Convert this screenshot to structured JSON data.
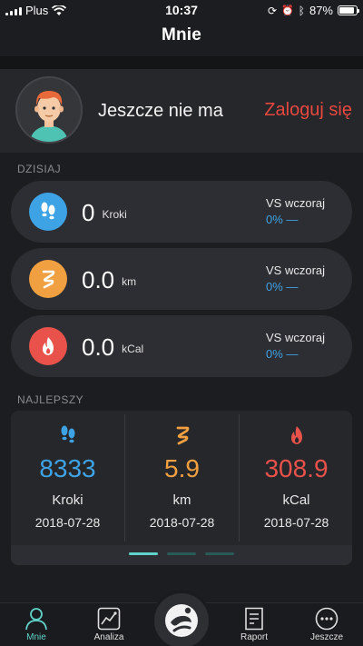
{
  "status_bar": {
    "carrier": "Plus",
    "time": "10:37",
    "battery": "87%",
    "battery_level": 0.87
  },
  "header": {
    "title": "Mnie"
  },
  "profile": {
    "name": "Jeszcze nie ma",
    "login_label": "Zaloguj się"
  },
  "today": {
    "section_label": "DZISIAJ",
    "items": [
      {
        "value": "0",
        "unit": "Kroki",
        "vs_label": "VS wczoraj",
        "change": "0% —",
        "icon": "footprints-icon",
        "color": "#3ea3e5"
      },
      {
        "value": "0.0",
        "unit": "km",
        "vs_label": "VS wczoraj",
        "change": "0% —",
        "icon": "route-icon",
        "color": "#f0a040"
      },
      {
        "value": "0.0",
        "unit": "kCal",
        "vs_label": "VS wczoraj",
        "change": "0% —",
        "icon": "flame-icon",
        "color": "#e8524a"
      }
    ]
  },
  "best": {
    "section_label": "NAJLEPSZY",
    "items": [
      {
        "value": "8333",
        "label": "Kroki",
        "date": "2018-07-28",
        "color": "#3ea3e5",
        "icon": "footprints-icon"
      },
      {
        "value": "5.9",
        "label": "km",
        "date": "2018-07-28",
        "color": "#f0a040",
        "icon": "route-icon"
      },
      {
        "value": "308.9",
        "label": "kCal",
        "date": "2018-07-28",
        "color": "#e8524a",
        "icon": "flame-icon"
      }
    ],
    "pages": 3,
    "active_page": 1
  },
  "tab_bar": {
    "tabs": [
      {
        "label": "Mnie",
        "icon": "person-icon",
        "active": true
      },
      {
        "label": "Analiza",
        "icon": "chart-icon",
        "active": false
      },
      {
        "label": "Raport",
        "icon": "report-icon",
        "active": false
      },
      {
        "label": "Jeszcze",
        "icon": "more-icon",
        "active": false
      }
    ],
    "center_icon": "runner-icon"
  },
  "colors": {
    "accent": "#5fd3c9",
    "login": "#e8473f",
    "change": "#3ea3e5"
  }
}
